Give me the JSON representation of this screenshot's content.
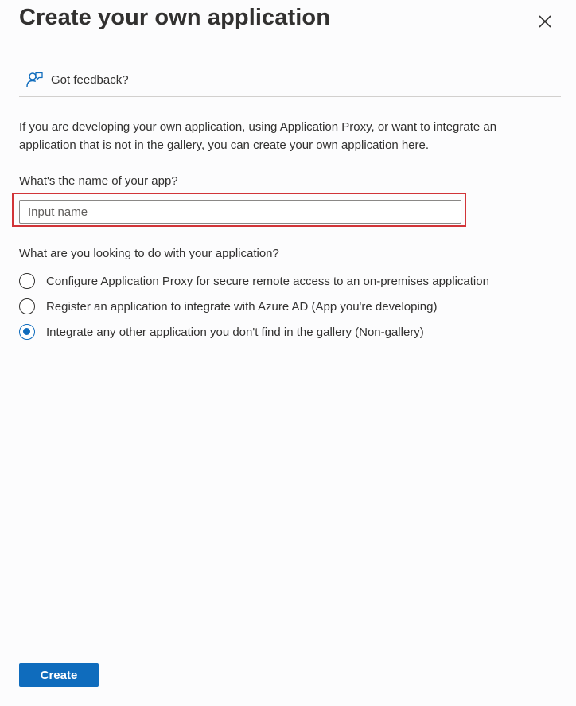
{
  "dialog": {
    "title": "Create your own application",
    "close_icon": "close-icon"
  },
  "feedback": {
    "icon": "feedback-person-icon",
    "label": "Got feedback?"
  },
  "description": "If you are developing your own application, using Application Proxy, or want to integrate an application that is not in the gallery, you can create your own application here.",
  "name_field": {
    "label": "What's the name of your app?",
    "placeholder": "Input name",
    "value": "",
    "highlight_color": "#d13438"
  },
  "purpose": {
    "question": "What are you looking to do with your application?",
    "options": [
      {
        "label": "Configure Application Proxy for secure remote access to an on-premises application",
        "checked": false
      },
      {
        "label": "Register an application to integrate with Azure AD (App you're developing)",
        "checked": false
      },
      {
        "label": "Integrate any other application you don't find in the gallery (Non-gallery)",
        "checked": true
      }
    ]
  },
  "footer": {
    "create_label": "Create"
  },
  "colors": {
    "accent": "#0f6cbd",
    "text": "#323130",
    "divider": "#d2d0ce",
    "background": "#fcfcfd"
  }
}
